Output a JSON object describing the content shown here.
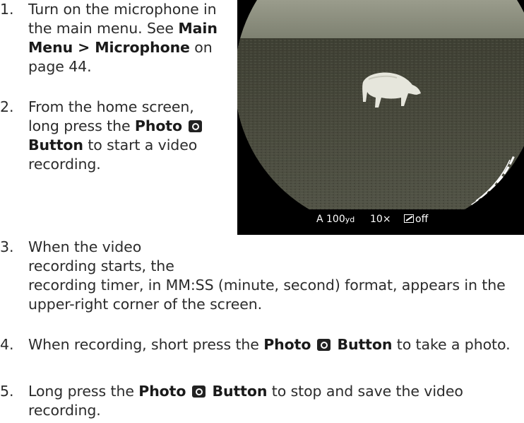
{
  "steps": [
    {
      "number": "1.",
      "text_a": "Turn on the microphone in the main menu. See ",
      "bold_a": "Main Menu > Microphone",
      "text_b": " on page 44."
    },
    {
      "number": "2.",
      "text_a": "From the home screen, long press the ",
      "bold_a": "Photo",
      "bold_b": "Button",
      "text_b": " to start a video recording."
    },
    {
      "number": "3.",
      "line_1": "When the video",
      "line_2": "recording starts, the",
      "line_rest": "recording timer, in MM:SS (minute, second) format, appears in the upper-right corner of the screen."
    },
    {
      "number": "4.",
      "text_a": "When recording, short press the ",
      "bold_a": "Photo",
      "bold_b": "Button",
      "text_b": " to take a photo."
    },
    {
      "number": "5.",
      "text_a": "Long press the ",
      "bold_a": "Photo",
      "bold_b": "Button",
      "text_b": " to stop and save the video recording."
    }
  ],
  "scope_hud": {
    "range": "A 100",
    "range_unit": "yd",
    "zoom": "10×",
    "pip_state": "off",
    "pip_icon": "picture-in-picture-icon"
  },
  "icons": {
    "photo_button": "camera-icon"
  },
  "colors": {
    "text": "#2b2b2b",
    "scope_bg": "#000000",
    "thermal_field": "#4a4a3c",
    "hud_text": "#ffffff"
  }
}
